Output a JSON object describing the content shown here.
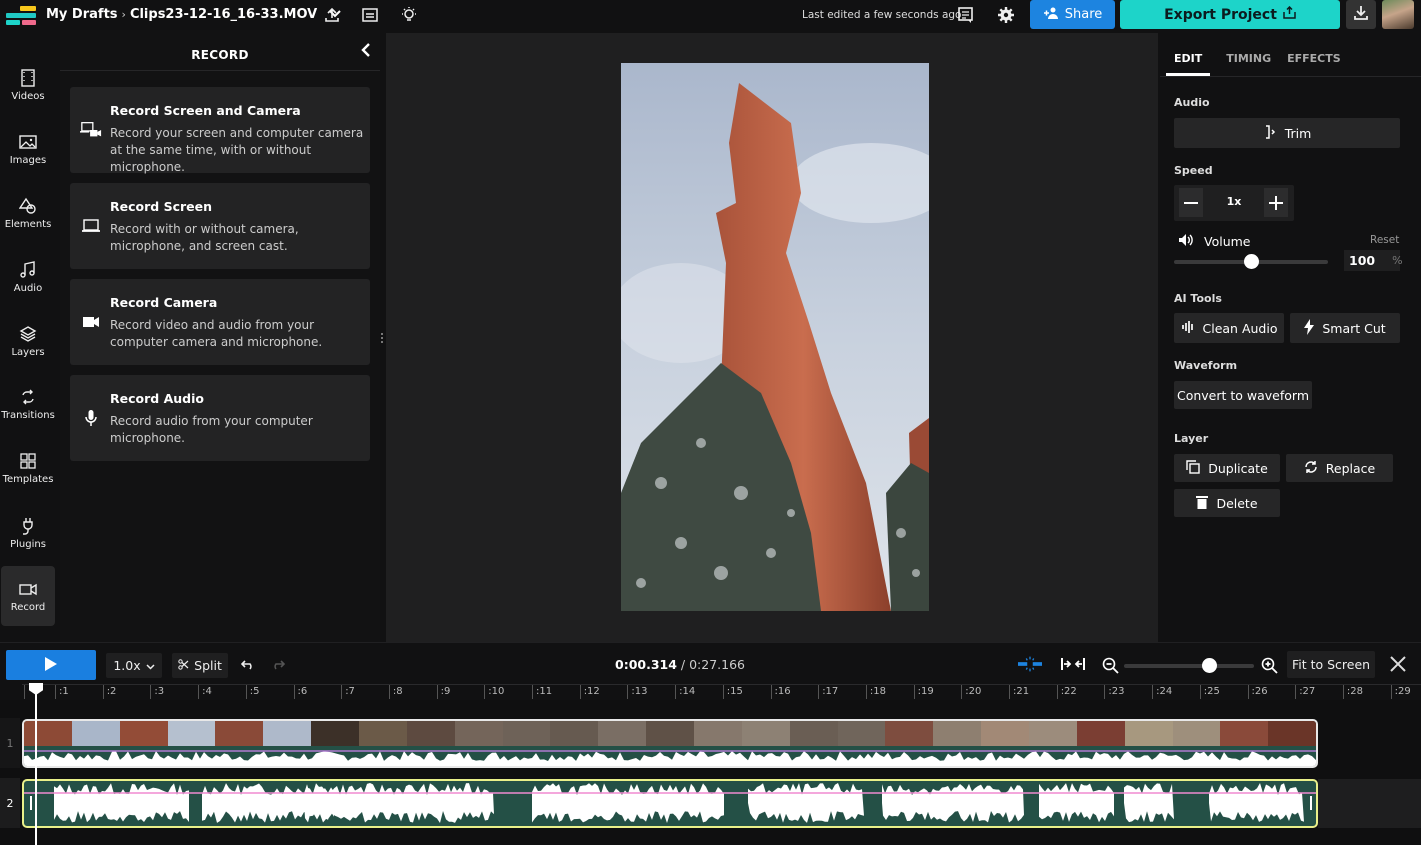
{
  "header": {
    "breadcrumb_root": "My Drafts",
    "breadcrumb_sep": "›",
    "file_name": "Clips23-12-16_16-33.MOV",
    "last_edited": "Last edited a few seconds ago",
    "share_label": "Share",
    "export_label": "Export Project",
    "icons": [
      "upload-icon",
      "subtitles-icon",
      "lightbulb-icon",
      "comments-icon",
      "gear-icon",
      "download-icon"
    ]
  },
  "sidebar": {
    "items": [
      {
        "label": "Videos",
        "icon": "film-icon"
      },
      {
        "label": "Images",
        "icon": "image-icon"
      },
      {
        "label": "Elements",
        "icon": "shapes-icon"
      },
      {
        "label": "Audio",
        "icon": "music-note-icon"
      },
      {
        "label": "Layers",
        "icon": "layers-icon"
      },
      {
        "label": "Transitions",
        "icon": "transition-icon"
      },
      {
        "label": "Templates",
        "icon": "grid-icon"
      },
      {
        "label": "Plugins",
        "icon": "plug-icon"
      },
      {
        "label": "Record",
        "icon": "camera-icon",
        "active": true
      }
    ]
  },
  "record_panel": {
    "title": "RECORD",
    "options": [
      {
        "title": "Record Screen and Camera",
        "desc": "Record your screen and computer camera at the same time, with or without microphone.",
        "icon": "screen-camera-icon"
      },
      {
        "title": "Record Screen",
        "desc": "Record with or without camera, microphone, and screen cast.",
        "icon": "laptop-icon"
      },
      {
        "title": "Record Camera",
        "desc": "Record video and audio from your computer camera and microphone.",
        "icon": "video-camera-icon"
      },
      {
        "title": "Record Audio",
        "desc": "Record audio from your computer microphone.",
        "icon": "microphone-icon"
      }
    ]
  },
  "properties": {
    "tabs": [
      "EDIT",
      "TIMING",
      "EFFECTS"
    ],
    "active_tab": "EDIT",
    "audio_label": "Audio",
    "trim_label": "Trim",
    "speed_label": "Speed",
    "speed_value": "1x",
    "volume_label": "Volume",
    "reset_label": "Reset",
    "volume_value": "100",
    "volume_unit": "%",
    "volume_slider_fraction": 0.5,
    "ai_tools_label": "AI Tools",
    "clean_audio_label": "Clean Audio",
    "smart_cut_label": "Smart Cut",
    "waveform_label": "Waveform",
    "convert_waveform_label": "Convert to waveform",
    "layer_label": "Layer",
    "duplicate_label": "Duplicate",
    "replace_label": "Replace",
    "delete_label": "Delete"
  },
  "timeline": {
    "playback_speed": "1.0x",
    "split_label": "Split",
    "current_time": "0:00.314",
    "time_sep": " / ",
    "total_time": "0:27.166",
    "fit_label": "Fit to Screen",
    "zoom_fraction": 0.65,
    "ruler_ticks": [
      ":1",
      ":2",
      ":3",
      ":4",
      ":5",
      ":6",
      ":7",
      ":8",
      ":9",
      ":10",
      ":11",
      ":12",
      ":13",
      ":14",
      ":15",
      ":16",
      ":17",
      ":18",
      ":19",
      ":20",
      ":21",
      ":22",
      ":23",
      ":24",
      ":25",
      ":26",
      ":27",
      ":28",
      ":29"
    ],
    "tracks": [
      {
        "label": "1"
      },
      {
        "label": "2"
      }
    ]
  }
}
